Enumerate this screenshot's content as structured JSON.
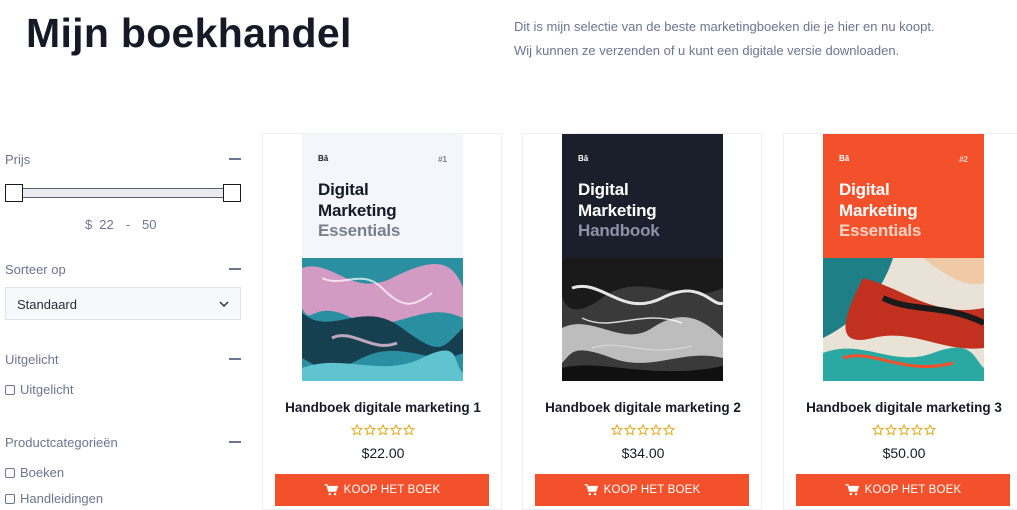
{
  "header": {
    "title": "Mijn boekhandel",
    "intro_line1": "Dit is mijn selectie van de beste marketingboeken die je hier en nu koopt.",
    "intro_line2": "Wij kunnen ze verzenden of u kunt een digitale versie downloaden."
  },
  "sidebar": {
    "price": {
      "label": "Prijs",
      "currency": "$",
      "min": "22",
      "max": "50",
      "separator": "-"
    },
    "sort": {
      "label": "Sorteer op",
      "selected": "Standaard"
    },
    "featured": {
      "label": "Uitgelicht",
      "option": "Uitgelicht"
    },
    "categories": {
      "label": "Productcategorieën",
      "options": [
        "Boeken",
        "Handleidingen"
      ]
    }
  },
  "products": [
    {
      "name": "Handboek digitale marketing 1",
      "price": "$22.00",
      "button": "KOOP HET BOEK",
      "cover": {
        "brand": "Bā",
        "number": "#1",
        "line1": "Digital",
        "line2": "Marketing",
        "line3": "Essentials",
        "bg": "#f4f6fb",
        "text_color": "#161a26",
        "accent_color": "#7a7f8c"
      },
      "rating": 0
    },
    {
      "name": "Handboek digitale marketing 2",
      "price": "$34.00",
      "button": "KOOP HET BOEK",
      "cover": {
        "brand": "Bā",
        "number": "",
        "line1": "Digital",
        "line2": "Marketing",
        "line3": "Handbook",
        "bg": "#1b1e2b",
        "text_color": "#ffffff",
        "accent_color": "#8c93a8"
      },
      "rating": 0
    },
    {
      "name": "Handboek digitale marketing 3",
      "price": "$50.00",
      "button": "KOOP HET BOEK",
      "cover": {
        "brand": "Bā",
        "number": "#2",
        "line1": "Digital",
        "line2": "Marketing",
        "line3": "Essentials",
        "bg": "#f3512b",
        "text_color": "#ffffff",
        "accent_color": "#ffd2c4"
      },
      "rating": 0
    }
  ],
  "colors": {
    "accent": "#f3512b",
    "star": "#e2a81b",
    "muted_text": "#6c7591"
  }
}
